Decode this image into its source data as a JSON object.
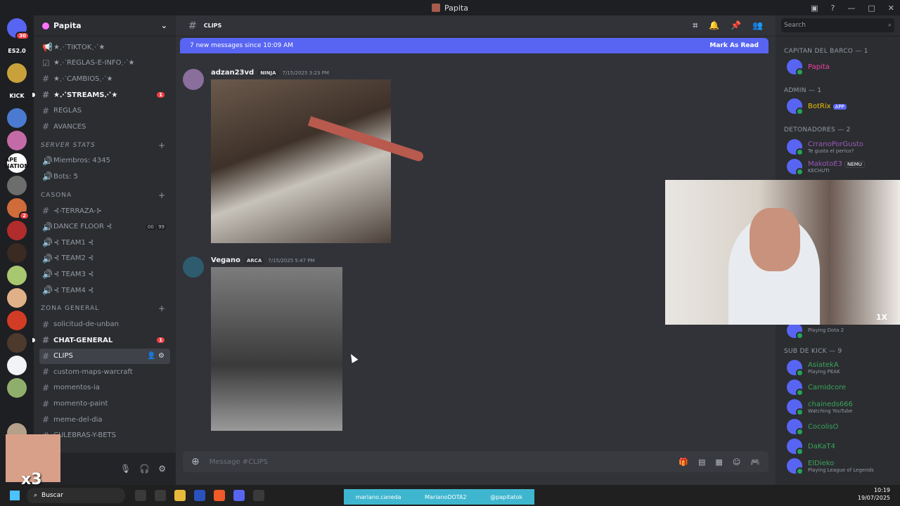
{
  "window": {
    "title": "Papita"
  },
  "guild_list": [
    {
      "label": "",
      "color": "#5865f2",
      "badge": "30"
    },
    {
      "label": "ES2.0",
      "color": "#1e1f22",
      "badge": ""
    },
    {
      "label": "",
      "color": "#c9a13b",
      "badge": ""
    },
    {
      "label": "KICK",
      "color": "#1e1f22",
      "badge": ""
    },
    {
      "label": "",
      "color": "#4a7bd1",
      "badge": ""
    },
    {
      "label": "",
      "color": "#c36ba7",
      "badge": ""
    },
    {
      "label": "APE NATION",
      "color": "#ffffff",
      "badge": ""
    },
    {
      "label": "",
      "color": "#6d6d6d",
      "badge": ""
    },
    {
      "label": "",
      "color": "#d06b3a",
      "badge": "2"
    },
    {
      "label": "",
      "color": "#b12c2c",
      "badge": ""
    },
    {
      "label": "",
      "color": "#3a2a22",
      "badge": ""
    },
    {
      "label": "",
      "color": "#a8c870",
      "badge": ""
    },
    {
      "label": "",
      "color": "#e0b088",
      "badge": ""
    },
    {
      "label": "",
      "color": "#d23c25",
      "badge": ""
    },
    {
      "label": "",
      "color": "#4d3a2d",
      "badge": ""
    },
    {
      "label": "",
      "color": "#f2f3f5",
      "badge": ""
    },
    {
      "label": "",
      "color": "#8fae6c",
      "badge": ""
    },
    {
      "label": "",
      "color": "#1e1f22",
      "badge": ""
    },
    {
      "label": "",
      "color": "#b5a08a",
      "badge": ""
    }
  ],
  "server": {
    "name": "Papita"
  },
  "channels": [
    {
      "type": "text",
      "label": "★⋰TIKTOK⋰★",
      "state": ""
    },
    {
      "type": "text",
      "label": "★⋰REGLAS-E-INFO⋰★",
      "state": ""
    },
    {
      "type": "text",
      "label": "★⋰CAMBIOS⋰★",
      "state": ""
    },
    {
      "type": "text",
      "label": "★⋰STREAMS⋰★",
      "state": "unread",
      "badge": "1"
    },
    {
      "type": "text",
      "label": "REGLAS",
      "state": ""
    },
    {
      "type": "text",
      "label": "AVANCES",
      "state": ""
    }
  ],
  "categories": {
    "server_stats": "SERVER STATS",
    "casona": "CASONA",
    "zona_general": "ZONA GENERAL"
  },
  "stats_channels": [
    {
      "label": "Miembros: 4345"
    },
    {
      "label": "Bots: 5"
    }
  ],
  "voice_channels": [
    {
      "label": "⊰-TERRAZA-⊱",
      "counter": ""
    },
    {
      "label": "DANCE FLOOR ⊰",
      "counter_a": "00",
      "counter_b": "99"
    },
    {
      "label": "⊰ TEAM1 ⊰",
      "counter": ""
    },
    {
      "label": "⊰ TEAM2 ⊰",
      "counter": ""
    },
    {
      "label": "⊰ TEAM3 ⊰",
      "counter": ""
    },
    {
      "label": "⊰ TEAM4 ⊰",
      "counter": ""
    }
  ],
  "general_channels": [
    {
      "label": "solicitud-de-unban",
      "state": ""
    },
    {
      "label": "CHAT-GENERAL",
      "state": "unread",
      "badge": "1"
    },
    {
      "label": "CLIPS",
      "state": "active"
    },
    {
      "label": "custom-maps-warcraft",
      "state": ""
    },
    {
      "label": "momentos-ia",
      "state": ""
    },
    {
      "label": "momento-paint",
      "state": ""
    },
    {
      "label": "meme-del-dia",
      "state": ""
    },
    {
      "label": "CULEBRAS-Y-BETS",
      "state": ""
    }
  ],
  "channel_header": {
    "name": "CLIPS"
  },
  "new_messages_bar": {
    "text": "7 new messages since 10:09 AM",
    "action": "Mark As Read"
  },
  "messages": [
    {
      "author": "adzan23vd",
      "tag": "NINJA",
      "time": "7/15/2025 3:23 PM"
    },
    {
      "author": "Vegano",
      "tag": "ARCA",
      "time": "7/15/2025 5:47 PM"
    }
  ],
  "composer": {
    "placeholder": "Message #CLIPS"
  },
  "member_search": {
    "placeholder": "Search"
  },
  "member_groups": {
    "capitan": "CAPITAN DEL BARCO — 1",
    "admin": "ADMIN — 1",
    "detonadores": "DETONADORES — 2",
    "subkick": "SUB DE KICK — 9"
  },
  "members": {
    "capitan": [
      {
        "name": "Papita",
        "color": "#f23fa0",
        "status": ""
      }
    ],
    "admin": [
      {
        "name": "BotRix",
        "color": "#f0c000",
        "app": "APP",
        "status": ""
      }
    ],
    "detonadores": [
      {
        "name": "CrranoPorGusto",
        "color": "#9b59b6",
        "status": "Te gusta el perico?"
      },
      {
        "name": "MakotoE3",
        "color": "#9b59b6",
        "nemu": "NEMU",
        "status": "KECHUTI"
      }
    ],
    "partial": [
      {
        "name": "",
        "color": "#f23f43",
        "status": "Playing Dota 2"
      }
    ],
    "subkick": [
      {
        "name": "AsiatekA",
        "color": "#3ba55c",
        "status": "Playing PEAK"
      },
      {
        "name": "Carnidcore",
        "color": "#3ba55c",
        "status": ""
      },
      {
        "name": "chaineds666",
        "color": "#3ba55c",
        "status": "Watching YouTube"
      },
      {
        "name": "CocolisO",
        "color": "#3ba55c",
        "status": ""
      },
      {
        "name": "DaKaT4",
        "color": "#3ba55c",
        "status": ""
      },
      {
        "name": "ElDieko",
        "color": "#3ba55c",
        "status": "Playing League of Legends"
      }
    ]
  },
  "webcam": {
    "zoom": "1X"
  },
  "overlay": {
    "multiplier": "x3"
  },
  "taskbar": {
    "search": "Buscar",
    "clock_time": "10:19",
    "clock_date": "19/07/2025"
  },
  "socials": [
    {
      "label": "mariano.caneda"
    },
    {
      "label": "MarianoDOTA2"
    },
    {
      "label": "@papitatok"
    }
  ]
}
